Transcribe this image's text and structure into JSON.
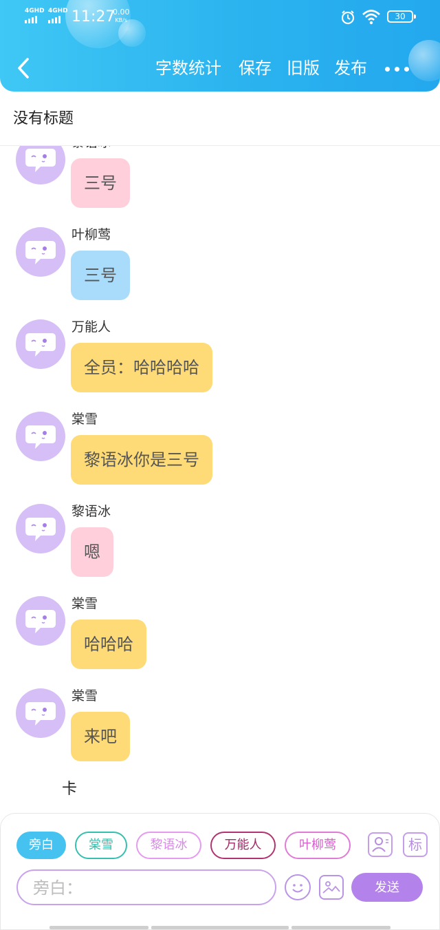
{
  "status_bar": {
    "signal1": "4GHD",
    "signal2": "4GHD",
    "time": "11:27",
    "speed_value": "0.00",
    "speed_unit": "KB/s",
    "battery": "30"
  },
  "nav": {
    "word_count": "字数统计",
    "save": "保存",
    "old_version": "旧版",
    "publish": "发布"
  },
  "doc": {
    "title": "没有标题"
  },
  "messages": [
    {
      "name": "黎语冰",
      "text": "三号",
      "color": "#ffd0dc"
    },
    {
      "name": "叶柳莺",
      "text": "三号",
      "color": "#a9dcfb"
    },
    {
      "name": "万能人",
      "text": "全员：哈哈哈哈",
      "color": "#fedb76"
    },
    {
      "name": "棠雪",
      "text": "黎语冰你是三号",
      "color": "#fedb76"
    },
    {
      "name": "黎语冰",
      "text": "嗯",
      "color": "#ffd0dc"
    },
    {
      "name": "棠雪",
      "text": "哈哈哈",
      "color": "#fedb76"
    },
    {
      "name": "棠雪",
      "text": "来吧",
      "color": "#fedb76"
    }
  ],
  "pending_text": "卡",
  "characters": [
    {
      "label": "旁白",
      "active": true
    },
    {
      "label": "棠雪",
      "active": false
    },
    {
      "label": "黎语冰",
      "active": false
    },
    {
      "label": "万能人",
      "active": false
    },
    {
      "label": "叶柳莺",
      "active": false
    }
  ],
  "tools": {
    "mark": "标"
  },
  "composer": {
    "placeholder": "旁白：",
    "send": "发送"
  },
  "colors": {
    "header": "#2bb3ef",
    "accent_purple": "#b382ea",
    "avatar": "#d6bff6"
  }
}
